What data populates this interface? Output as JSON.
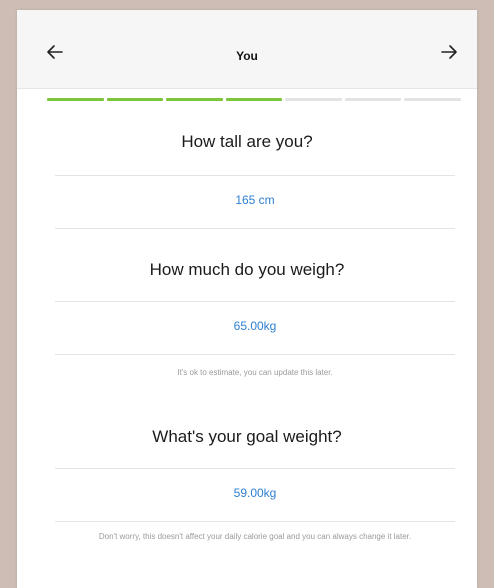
{
  "header": {
    "title": "You",
    "back_icon": "arrow-left-icon",
    "next_icon": "arrow-right-icon"
  },
  "progress": {
    "segments_total": 7,
    "segments_completed": 4,
    "color_done": "#7dc63a",
    "color_remaining": "#e3e3e3"
  },
  "height": {
    "question": "How tall are you?",
    "value": "165 cm"
  },
  "weight": {
    "question": "How much do you weigh?",
    "value": "65.00kg",
    "hint": "It's ok to estimate, you can update this later."
  },
  "goal": {
    "question": "What's your goal weight?",
    "value": "59.00kg",
    "hint": "Don't worry, this doesn't affect your daily calorie goal and you can always change it later."
  },
  "colors": {
    "accent": "#2e7fd1"
  }
}
